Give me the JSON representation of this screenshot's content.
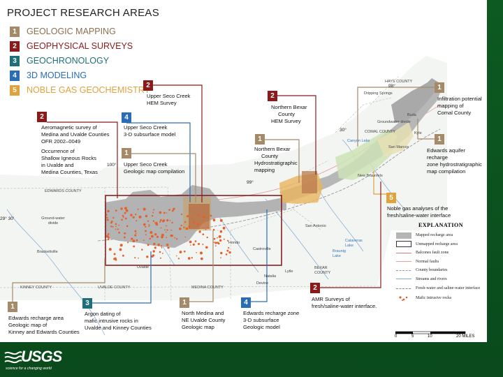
{
  "title": "PROJECT RESEARCH AREAS",
  "colors": {
    "geologic": "#a48a68",
    "geophysical": "#8c1a1a",
    "geochronology": "#1e6f7a",
    "modeling": "#2a6db5",
    "noble": "#e0a23c"
  },
  "legend": [
    {
      "num": "1",
      "label": "GEOLOGIC MAPPING",
      "color": "#a48a68",
      "text_color": "#8c6f4e"
    },
    {
      "num": "2",
      "label": "GEOPHYSICAL SURVEYS",
      "color": "#8c1a1a",
      "text_color": "#8c1a1a"
    },
    {
      "num": "3",
      "label": "GEOCHRONOLOGY",
      "color": "#1e6f7a",
      "text_color": "#1e6f7a"
    },
    {
      "num": "4",
      "label": "3D MODELING",
      "color": "#2a6db5",
      "text_color": "#2a6db5"
    },
    {
      "num": "5",
      "label": "NOBLE GAS GEOCHEMISTRY",
      "color": "#e0a23c",
      "text_color": "#e0a23c"
    }
  ],
  "callouts": {
    "aeromag": {
      "num": "2",
      "line1": "Aeromagnetic survey of",
      "line2": "Medina and Uvalde Counties",
      "line3": "OFR 2002–0049",
      "line4": "Occurrence of",
      "line5": "Shallow Igneous Rocks",
      "line6": "in Uvalde and",
      "line7": "Medina Counties, Texas"
    },
    "seco_model": {
      "num": "4",
      "line1": "Upper Seco Creek",
      "line2": "3-D subsurface model"
    },
    "seco_hem": {
      "num": "2",
      "line1": "Upper Seco Creek",
      "line2": "HEM Survey"
    },
    "seco_geo": {
      "num": "1",
      "line1": "Upper Seco Creek",
      "line2": "Geologic map compilation"
    },
    "bexar_hem": {
      "num": "2",
      "line1": "Northern Bexar",
      "line2": "County",
      "line3": "HEM Survey"
    },
    "bexar_hydro": {
      "num": "1",
      "line1": "Northern Bexar",
      "line2": "County",
      "line3": "Hydrostratigraphic",
      "line4": "mapping"
    },
    "comal": {
      "num": "1",
      "line1": "Infiltration potential",
      "line2": "mapping of",
      "line3": "Comal County"
    },
    "recharge_zone": {
      "num": "1",
      "line1": "Edwards aquifer recharge",
      "line2": "zone hydrostratigraphic",
      "line3": "map compilation"
    },
    "noble": {
      "num": "5",
      "line1": "Noble gas analyses of the",
      "line2": "fresh/saline-water interface"
    },
    "amr": {
      "num": "2",
      "line1": "AMR Surveys of",
      "line2": "fresh/saline-water interface."
    },
    "edwards_area": {
      "num": "1",
      "line1": "Edwards recharge area",
      "line2": "Geologic map of",
      "line3": "Kinney and Edwards Counties"
    },
    "argon": {
      "num": "3",
      "line1": "Argon dating of",
      "line2": "mafic intrusive rocks in",
      "line3": "Uvalde and Kinney Counties"
    },
    "medina": {
      "num": "1",
      "line1": "North Medina and",
      "line2": "NE Uvalde County",
      "line3": "Geologic map"
    },
    "edwards_model": {
      "num": "4",
      "line1": "Edwards recharge zone",
      "line2": "3-D subsurface",
      "line3": "Geologic model"
    }
  },
  "map_labels": {
    "hays": "HAYS COUNTY",
    "dripping": "Dripping Springs",
    "lon98": "98°",
    "buda": "Buda",
    "kyle": "Kyle",
    "gw_divide_east": "Groundwater divide",
    "san_marcos": "San Marcos",
    "comal_county": "COMAL COUNTY",
    "canyon_lake": "Canyon Lake",
    "new_braunfels": "New Braunfels",
    "lat30": "30°",
    "edwards_county": "EDWARDS COUNTY",
    "lon100": "100°",
    "lon99": "99°",
    "lat2930": "29° 30'",
    "gw_divide_west": "Ground-water divide",
    "brackettville": "Brackettville",
    "hondo": "Hondo",
    "castroville": "Castroville",
    "uvalde": "Uvalde",
    "san_antonio": "San Antonio",
    "calaveras": "Calaveras Lake",
    "braunig": "Braunig Lake",
    "bexar": "BEXAR COUNTY",
    "lytle": "Lytle",
    "natalia": "Natalia",
    "devine": "Devine",
    "kinney": "KINNEY COUNTY",
    "uvalde_county": "UVALDE COUNTY",
    "medina_county": "MEDINA COUNTY"
  },
  "explanation": {
    "title": "EXPLANATION",
    "items": [
      {
        "label": "Mapped recharge area",
        "type": "fill"
      },
      {
        "label": "Unmapped recharge area",
        "type": "box"
      },
      {
        "label": "Balcones fault zone",
        "type": "line-red"
      },
      {
        "label": "Normal faults",
        "type": "line-red2"
      },
      {
        "label": "County boundaries",
        "type": "line-gray"
      },
      {
        "label": "Streams and rivers",
        "type": "line-blue"
      },
      {
        "label": "Fresh-water and saline-water interface",
        "type": "line-dash"
      },
      {
        "label": "Mafic intrusive rocks",
        "type": "dots"
      }
    ]
  },
  "scale": {
    "t0": "0",
    "t1": "5",
    "t2": "10",
    "t3": "20 MILES"
  },
  "logo": {
    "name": "USGS",
    "tagline": "science for a changing world"
  }
}
